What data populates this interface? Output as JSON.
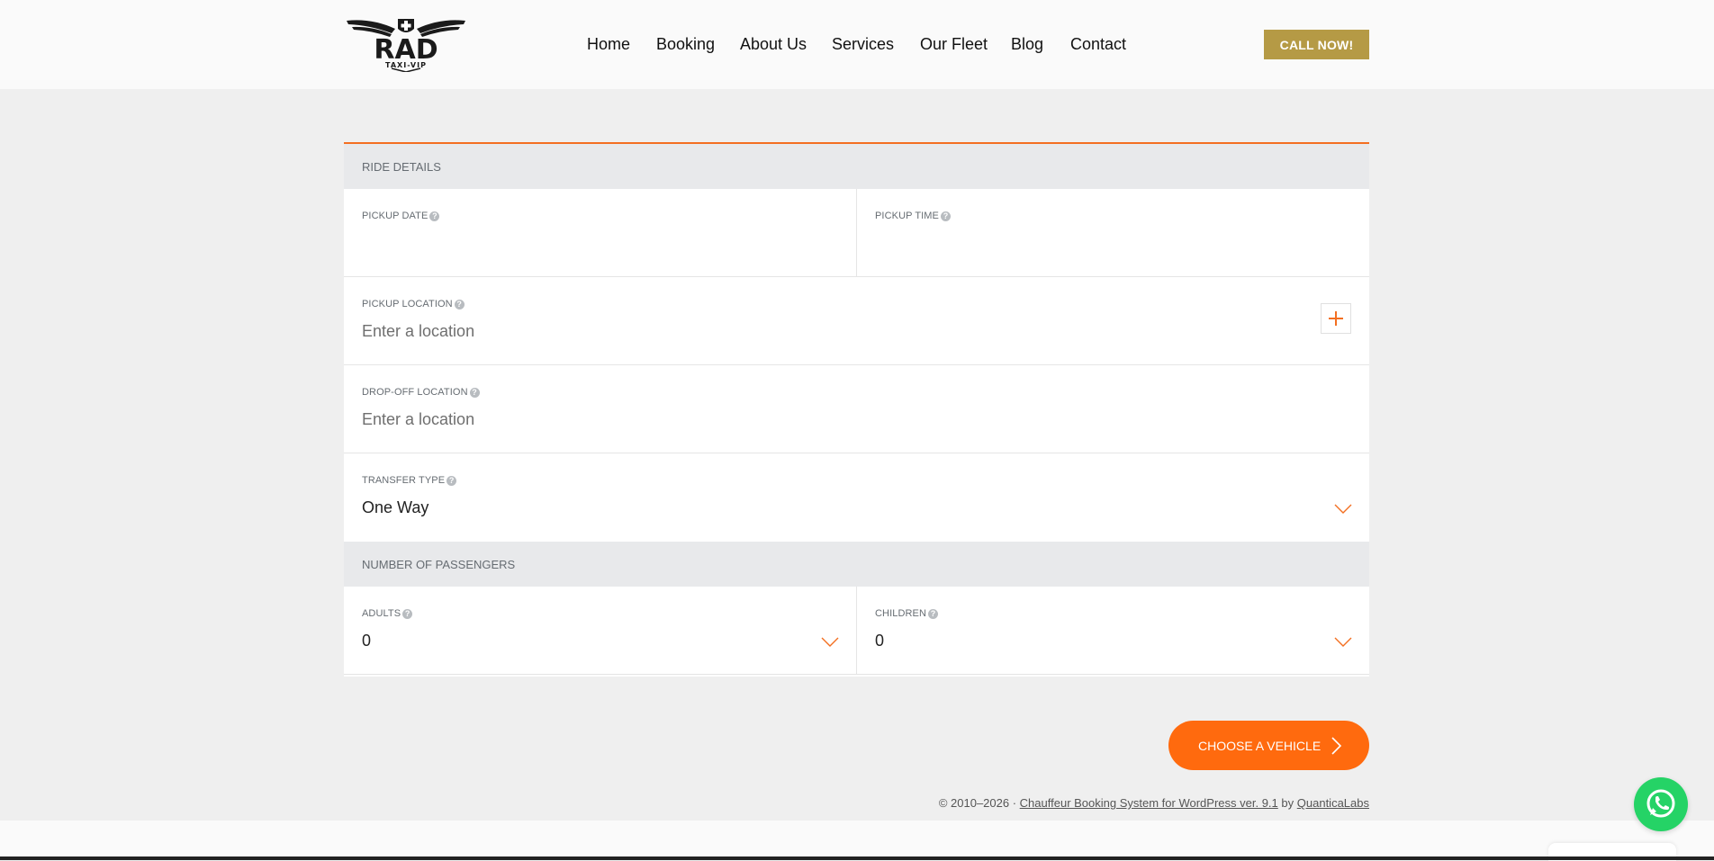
{
  "brand": {
    "logo_main": "RAD",
    "logo_sub": "TAXI-VIP"
  },
  "nav": {
    "items": [
      {
        "label": "Home"
      },
      {
        "label": "Booking"
      },
      {
        "label": "About Us"
      },
      {
        "label": "Services"
      },
      {
        "label": "Our Fleet"
      },
      {
        "label": "Blog"
      },
      {
        "label": "Contact"
      }
    ],
    "call_button": "CALL NOW!"
  },
  "form": {
    "ride_details_heading": "RIDE DETAILS",
    "pickup_date": {
      "label": "PICKUP DATE",
      "value": ""
    },
    "pickup_time": {
      "label": "PICKUP TIME",
      "value": ""
    },
    "pickup_location": {
      "label": "PICKUP LOCATION",
      "placeholder": "Enter a location"
    },
    "dropoff_location": {
      "label": "DROP-OFF LOCATION",
      "placeholder": "Enter a location"
    },
    "transfer_type": {
      "label": "TRANSFER TYPE",
      "value": "One Way"
    },
    "passengers_heading": "NUMBER OF PASSENGERS",
    "adults": {
      "label": "ADULTS",
      "value": "0"
    },
    "children": {
      "label": "CHILDREN",
      "value": "0"
    },
    "help_glyph": "?"
  },
  "actions": {
    "choose_vehicle": "CHOOSE A VEHICLE"
  },
  "footer": {
    "copyright": "© 2010–2026 ·",
    "plugin_link": "Chauffeur Booking System for WordPress ver. 9.1",
    "by": "by",
    "author_link": "QuanticaLabs"
  },
  "colors": {
    "accent": "#ff6a0e",
    "gold": "#b59a45",
    "whatsapp": "#25d366"
  },
  "icons": [
    "help-icon",
    "plus-icon",
    "chevron-down-icon",
    "chevron-right-icon",
    "whatsapp-icon"
  ]
}
